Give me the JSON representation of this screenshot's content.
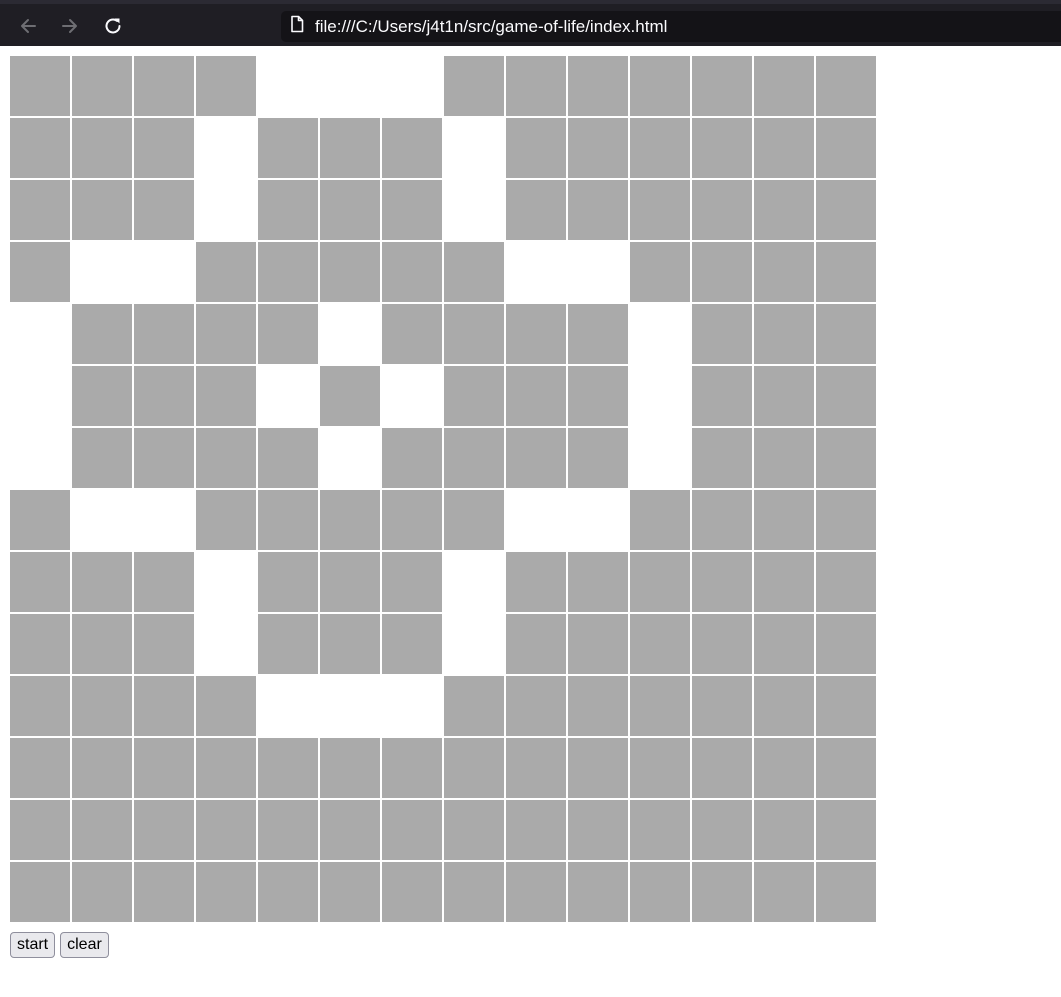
{
  "browser": {
    "url": "file:///C:/Users/j4t1n/src/game-of-life/index.html",
    "icons": {
      "back": "back-arrow-icon",
      "forward": "forward-arrow-icon",
      "reload": "reload-icon",
      "page": "file-page-icon"
    }
  },
  "grid": {
    "rows": 14,
    "cols": 14,
    "dead_color": "#aaaaaa",
    "alive_color": "#ffffff",
    "cells": [
      "....###.......",
      "...#...#......",
      "...#...#......",
      ".##.....##....",
      "#....#....#...",
      "#...#.#...#...",
      "#....#....#...",
      ".##.....##....",
      "...#...#......",
      "...#...#......",
      "....###.......",
      "..............",
      "..............",
      ".............."
    ]
  },
  "controls": {
    "start_label": "start",
    "clear_label": "clear"
  }
}
